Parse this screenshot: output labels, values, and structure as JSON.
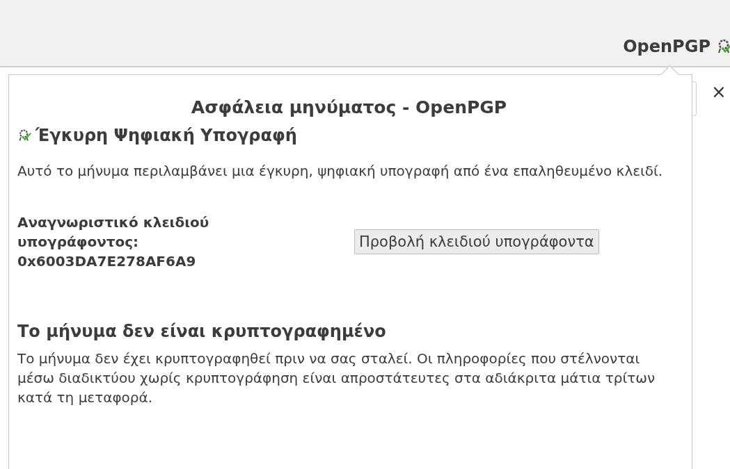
{
  "toolbar": {
    "label": "OpenPGP"
  },
  "popup": {
    "title": "Ασφάλεια μηνύματος - OpenPGP",
    "signature": {
      "heading": "Έγκυρη Ψηφιακή Υπογραφή",
      "text": "Αυτό το μήνυμα περιλαμβάνει μια έγκυρη, ψηφιακή υπογραφή από ένα επαληθευμένο κλειδί."
    },
    "signer": {
      "label": "Αναγνωριστικό κλειδιού υπογράφοντος:",
      "key_id": "0x6003DA7E278AF6A9",
      "button": "Προβολή κλειδιού υπογράφοντα"
    },
    "encryption": {
      "heading": "Το μήνυμα δεν είναι κρυπτογραφημένο",
      "text": "Το μήνυμα δεν έχει κρυπτογραφηθεί πριν να σας σταλεί. Οι πληροφορίες που στέλνονται μέσω διαδικτύου χωρίς κρυπτογράφηση είναι απροστάτευτες στα αδιάκριτα μάτια τρίτων κατά τη μεταφορά."
    }
  },
  "close_symbol": "×"
}
